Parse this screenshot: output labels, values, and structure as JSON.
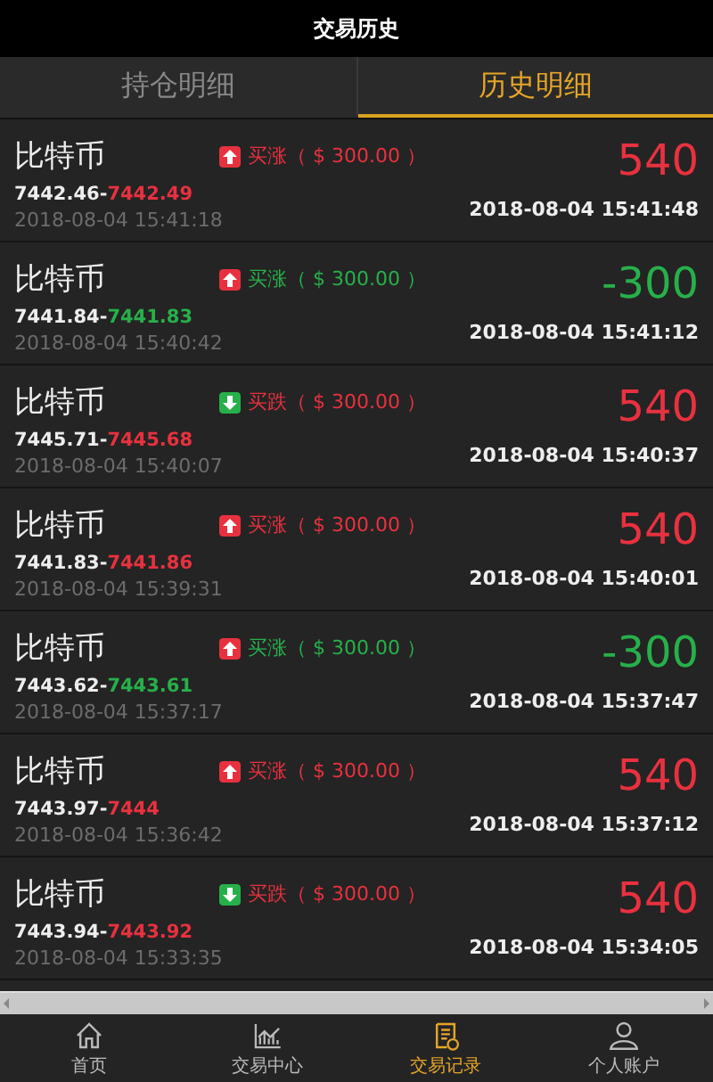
{
  "header": {
    "title": "交易历史"
  },
  "tabs": [
    {
      "label": "持仓明细",
      "selected": false
    },
    {
      "label": "历史明细",
      "selected": true
    }
  ],
  "trades": [
    {
      "asset": "比特币",
      "kind": "up",
      "color": "#e8313f",
      "order": "买涨（ $ 300.00 ）",
      "open_price": "7442.46-",
      "close_price": "7442.49",
      "open_time": "2018-08-04 15:41:18",
      "profit": "540",
      "close_time": "2018-08-04 15:41:48"
    },
    {
      "asset": "比特币",
      "kind": "up",
      "color": "#27b04a",
      "order": "买涨（ $ 300.00 ）",
      "open_price": "7441.84-",
      "close_price": "7441.83",
      "open_time": "2018-08-04 15:40:42",
      "profit": "-300",
      "close_time": "2018-08-04 15:41:12"
    },
    {
      "asset": "比特币",
      "kind": "down",
      "color": "#e8313f",
      "order": "买跌（ $ 300.00 ）",
      "open_price": "7445.71-",
      "close_price": "7445.68",
      "open_time": "2018-08-04 15:40:07",
      "profit": "540",
      "close_time": "2018-08-04 15:40:37"
    },
    {
      "asset": "比特币",
      "kind": "up",
      "color": "#e8313f",
      "order": "买涨（ $ 300.00 ）",
      "open_price": "7441.83-",
      "close_price": "7441.86",
      "open_time": "2018-08-04 15:39:31",
      "profit": "540",
      "close_time": "2018-08-04 15:40:01"
    },
    {
      "asset": "比特币",
      "kind": "up",
      "color": "#27b04a",
      "order": "买涨（ $ 300.00 ）",
      "open_price": "7443.62-",
      "close_price": "7443.61",
      "open_time": "2018-08-04 15:37:17",
      "profit": "-300",
      "close_time": "2018-08-04 15:37:47"
    },
    {
      "asset": "比特币",
      "kind": "up",
      "color": "#e8313f",
      "order": "买涨（ $ 300.00 ）",
      "open_price": "7443.97-",
      "close_price": "7444",
      "open_time": "2018-08-04 15:36:42",
      "profit": "540",
      "close_time": "2018-08-04 15:37:12"
    },
    {
      "asset": "比特币",
      "kind": "down",
      "color": "#e8313f",
      "order": "买跌（ $ 300.00 ）",
      "open_price": "7443.94-",
      "close_price": "7443.92",
      "open_time": "2018-08-04 15:33:35",
      "profit": "540",
      "close_time": "2018-08-04 15:34:05"
    }
  ],
  "nav": [
    {
      "kind": "home",
      "label": "首页",
      "selected": false
    },
    {
      "kind": "chart",
      "label": "交易中心",
      "selected": false
    },
    {
      "kind": "records",
      "label": "交易记录",
      "selected": true
    },
    {
      "kind": "account",
      "label": "个人账户",
      "selected": false
    }
  ]
}
